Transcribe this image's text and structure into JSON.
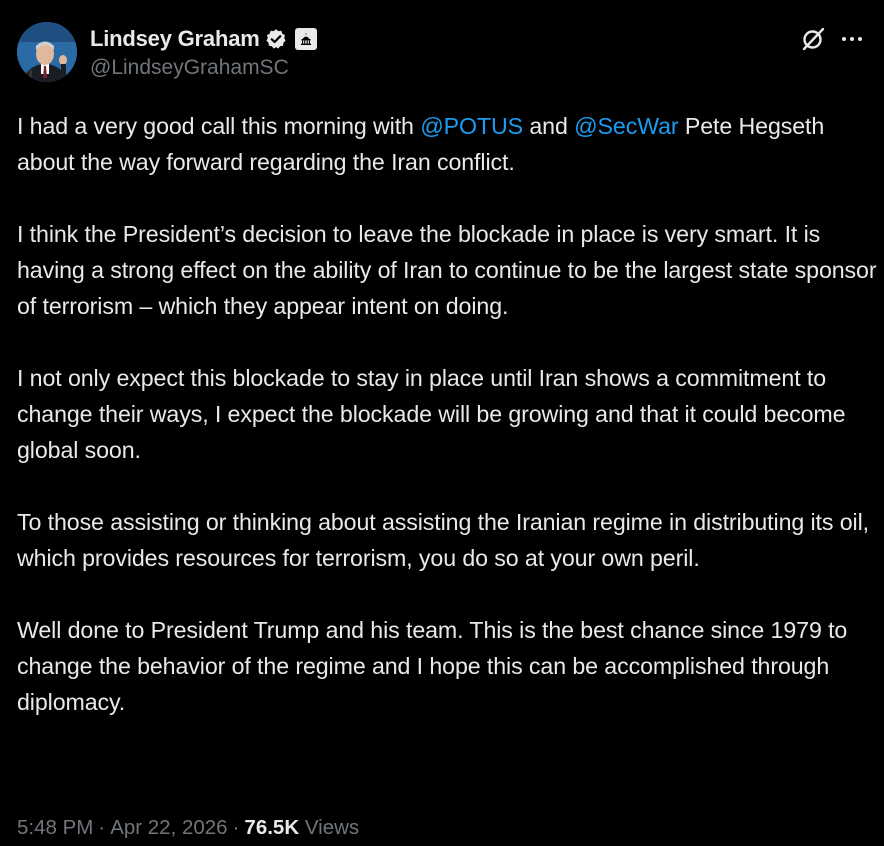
{
  "author": {
    "display_name": "Lindsey Graham",
    "handle": "@LindseyGrahamSC",
    "verified": true,
    "verified_color": "#1d9bf0",
    "affiliation_badge_icon": "capitol-building-icon"
  },
  "actions": {
    "grok_icon": "grok-icon",
    "more_icon": "more-icon"
  },
  "tweet": {
    "p1": {
      "t1": "I had a very good call this morning with ",
      "m1": "@POTUS",
      "t2": " and ",
      "m2": "@SecWar",
      "t3": " Pete Hegseth about the way forward regarding the Iran conflict."
    },
    "p2": "I think the President’s decision to leave the blockade in place is very smart. It is having a strong effect on the ability of Iran to continue to be the largest state sponsor of terrorism – which they appear intent on doing.",
    "p3": "I not only expect this blockade to stay in place until Iran shows a commitment to change their ways, I expect the blockade will be growing and that it could become global soon.",
    "p4": "To those assisting or thinking about assisting the Iranian regime in distributing its oil, which provides resources for terrorism, you do so at your own peril.",
    "p5": "Well done to President Trump and his team. This is the best chance since 1979 to change the behavior of the regime and I hope this can be accomplished through diplomacy."
  },
  "meta": {
    "time": "5:48 PM",
    "separator": "·",
    "date": "Apr 22, 2026",
    "views_count": "76.5K",
    "views_label": "Views"
  },
  "colors": {
    "background": "#000000",
    "text": "#e7e9ea",
    "secondary": "#71767b",
    "link": "#1d9bf0"
  }
}
